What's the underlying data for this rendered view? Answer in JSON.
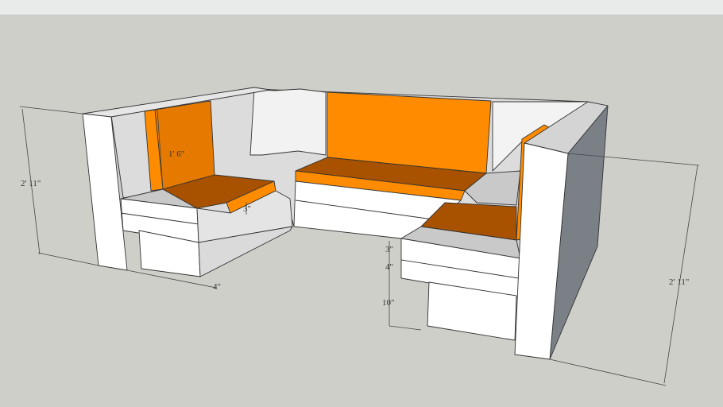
{
  "colors": {
    "background": "#cfcfca",
    "cushion": "#ff8c00",
    "cushion_shade": "#a85200",
    "white_face": "#ffffff",
    "gray_face": "#c9c9c9",
    "dark_face": "#7a8086"
  },
  "dimensions": {
    "left_height": "2' 11\"",
    "right_height": "2' 11\"",
    "backrest_height": "1' 6\"",
    "left_cushion_thickness": "3\"",
    "left_base_offset": "4\"",
    "right_cushion_thickness": "3\"",
    "right_seat_board": "4\"",
    "right_base_height": "10\""
  }
}
